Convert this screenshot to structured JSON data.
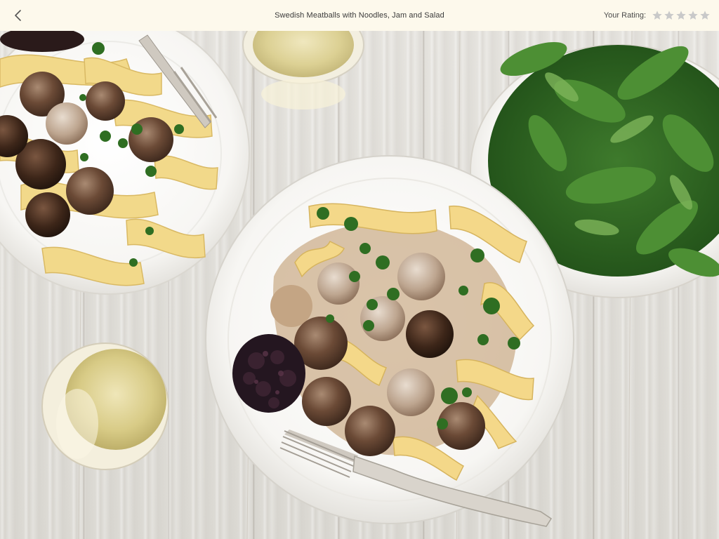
{
  "header": {
    "back_icon": "chevron-left-icon",
    "title": "Swedish Meatballs with Noodles, Jam and Salad",
    "rating_label": "Your Rating:",
    "rating": {
      "value": 0,
      "max": 5
    },
    "colors": {
      "bar_bg": "#fdf9ec",
      "star_empty": "#c9c9c9"
    }
  },
  "photo": {
    "subject": "Swedish meatballs with egg noodles, lingonberry jam, salad greens, and glasses of white wine on a whitewashed wood table"
  }
}
